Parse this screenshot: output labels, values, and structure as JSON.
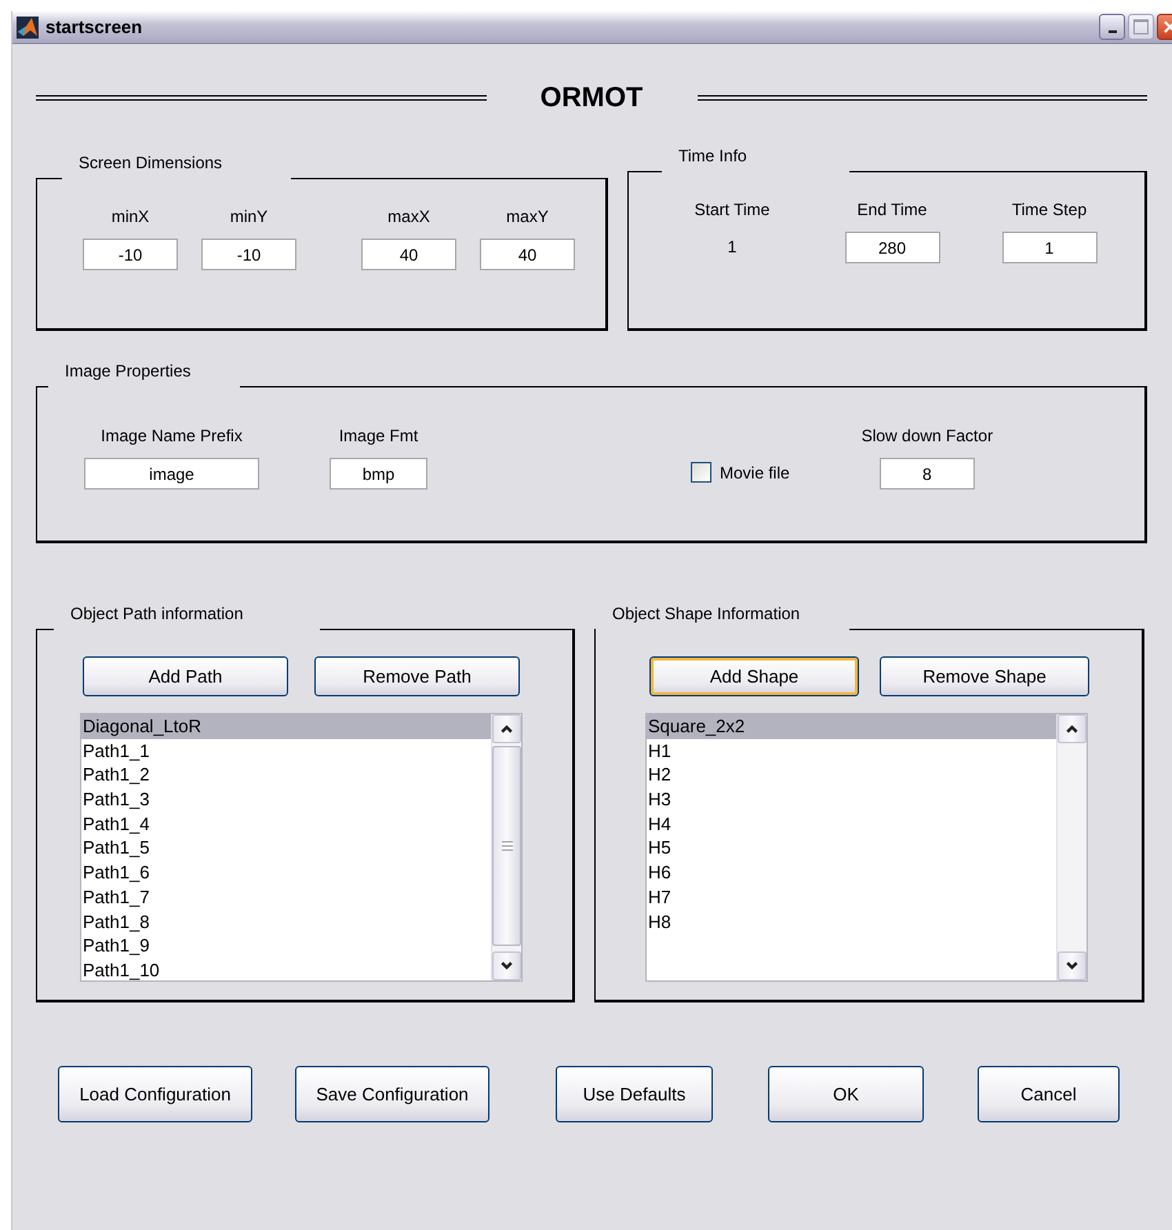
{
  "window": {
    "title": "startscreen"
  },
  "heading": "ORMOT",
  "screen_dimensions": {
    "title": "Screen Dimensions",
    "fields": [
      {
        "label": "minX",
        "value": "-10"
      },
      {
        "label": "minY",
        "value": "-10"
      },
      {
        "label": "maxX",
        "value": "40"
      },
      {
        "label": "maxY",
        "value": "40"
      }
    ]
  },
  "time_info": {
    "title": "Time Info",
    "items": [
      {
        "kind": "text",
        "label": "Start Time",
        "value": "1"
      },
      {
        "kind": "field",
        "label": "End Time",
        "value": "280"
      },
      {
        "kind": "field",
        "label": "Time Step",
        "value": "1"
      }
    ]
  },
  "image_properties": {
    "title": "Image Properties",
    "fields": [
      {
        "label": "Image Name Prefix",
        "value": "image"
      },
      {
        "label": "Image Fmt",
        "value": "bmp"
      }
    ],
    "movie_file": {
      "label": "Movie file",
      "checked": false
    },
    "slow_down": {
      "label": "Slow down Factor",
      "value": "8"
    }
  },
  "object_path": {
    "title": "Object Path information",
    "buttons": [
      {
        "label": "Add Path",
        "focused": false
      },
      {
        "label": "Remove Path",
        "focused": false
      }
    ],
    "scrollable": true,
    "items": [
      {
        "label": "Diagonal_LtoR",
        "selected": true
      },
      {
        "label": "Path1_1",
        "selected": false
      },
      {
        "label": "Path1_2",
        "selected": false
      },
      {
        "label": "Path1_3",
        "selected": false
      },
      {
        "label": "Path1_4",
        "selected": false
      },
      {
        "label": "Path1_5",
        "selected": false
      },
      {
        "label": "Path1_6",
        "selected": false
      },
      {
        "label": "Path1_7",
        "selected": false
      },
      {
        "label": "Path1_8",
        "selected": false
      },
      {
        "label": "Path1_9",
        "selected": false
      },
      {
        "label": "Path1_10",
        "selected": false
      }
    ]
  },
  "object_shape": {
    "title": "Object Shape Information",
    "buttons": [
      {
        "label": "Add Shape",
        "focused": true
      },
      {
        "label": "Remove Shape",
        "focused": false
      }
    ],
    "scrollable": false,
    "items": [
      {
        "label": "Square_2x2",
        "selected": true
      },
      {
        "label": "H1",
        "selected": false
      },
      {
        "label": "H2",
        "selected": false
      },
      {
        "label": "H3",
        "selected": false
      },
      {
        "label": "H4",
        "selected": false
      },
      {
        "label": "H5",
        "selected": false
      },
      {
        "label": "H6",
        "selected": false
      },
      {
        "label": "H7",
        "selected": false
      },
      {
        "label": "H8",
        "selected": false
      }
    ]
  },
  "buttons": [
    {
      "label": "Load Configuration",
      "focused": false
    },
    {
      "label": "Save Configuration",
      "focused": false
    },
    {
      "label": "Use Defaults",
      "focused": false
    },
    {
      "label": "OK",
      "focused": false
    },
    {
      "label": "Cancel",
      "focused": false
    }
  ]
}
